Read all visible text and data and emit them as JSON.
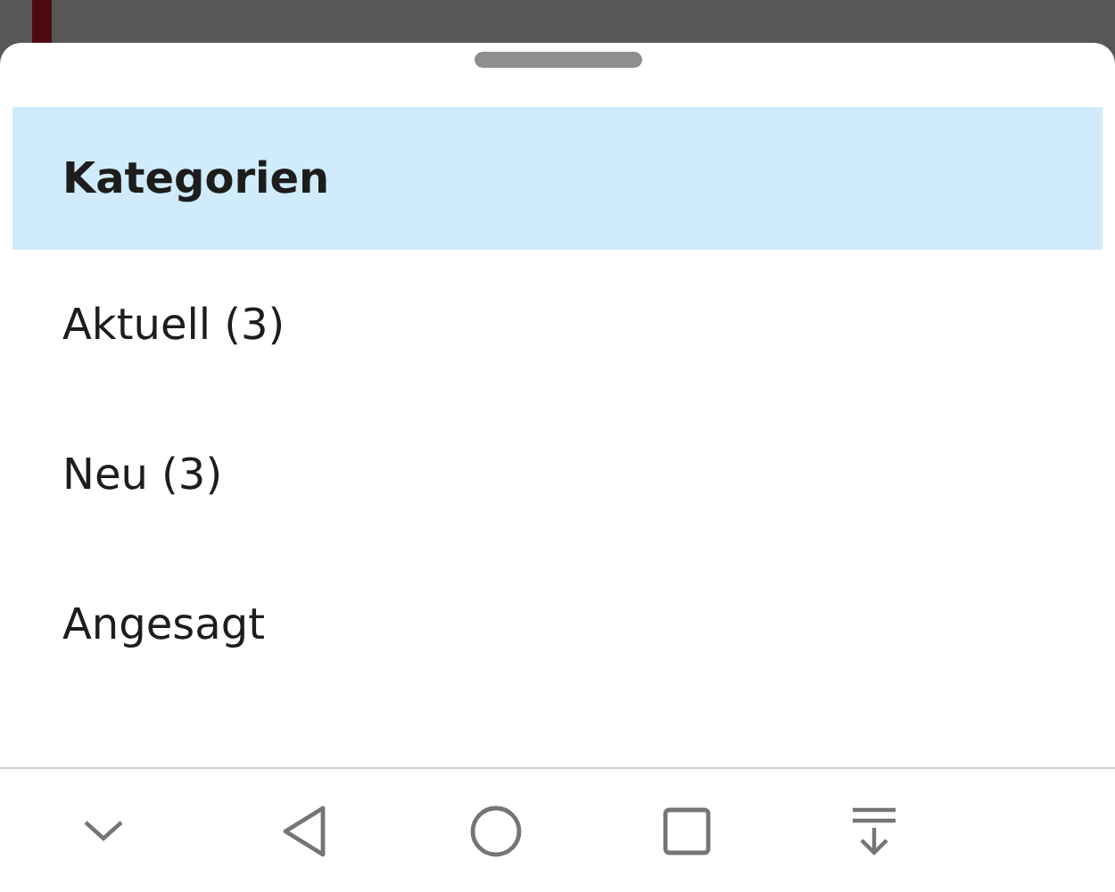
{
  "sheet": {
    "items": [
      {
        "label": "Kategorien",
        "selected": true
      },
      {
        "label": "Aktuell (3)",
        "selected": false
      },
      {
        "label": "Neu (3)",
        "selected": false
      },
      {
        "label": "Angesagt",
        "selected": false
      }
    ]
  }
}
